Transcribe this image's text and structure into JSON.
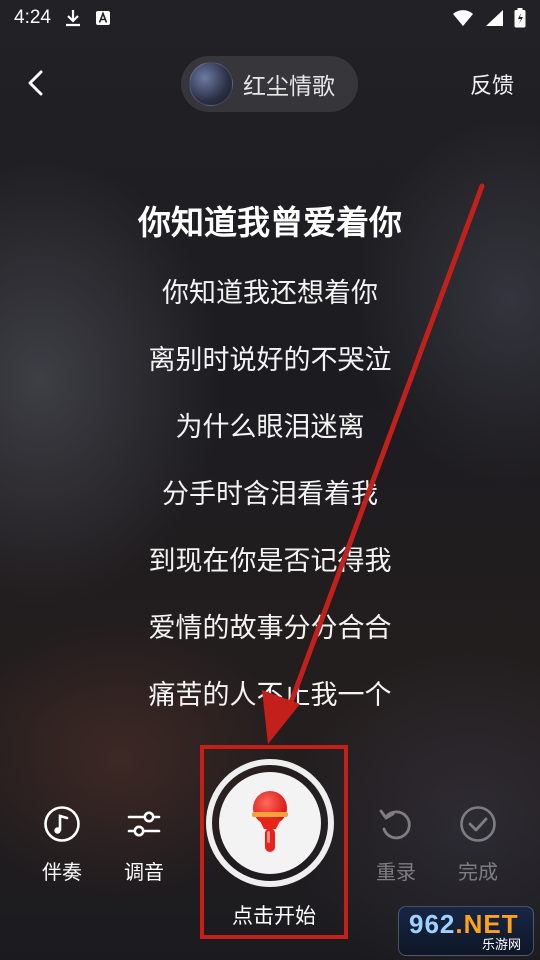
{
  "status_bar": {
    "time": "4:24"
  },
  "header": {
    "song_title": "红尘情歌",
    "feedback_label": "反馈"
  },
  "lyrics": {
    "current": "你知道我曾爱着你",
    "lines": [
      "你知道我还想着你",
      "离别时说好的不哭泣",
      "为什么眼泪迷离",
      "分手时含泪看着我",
      "到现在你是否记得我",
      "爱情的故事分分合合",
      "痛苦的人不止我一个"
    ]
  },
  "controls": {
    "accompaniment_label": "伴奏",
    "tuning_label": "调音",
    "record_label": "点击开始",
    "rerecord_label": "重录",
    "finish_label": "完成"
  },
  "watermark": {
    "brand_num": "962",
    "brand_suffix": ".NET",
    "brand_sub": "乐游网"
  },
  "colors": {
    "annotation_red": "#c3201c",
    "mic_red": "#e8231c",
    "disabled_gray": "#7d7d82",
    "watermark_orange": "#ffa21a"
  },
  "icons": {
    "back": "chevron-left-icon",
    "accompaniment": "music-note-icon",
    "tuning": "sliders-icon",
    "record": "microphone-icon",
    "rerecord": "undo-icon",
    "finish": "check-circle-icon"
  }
}
